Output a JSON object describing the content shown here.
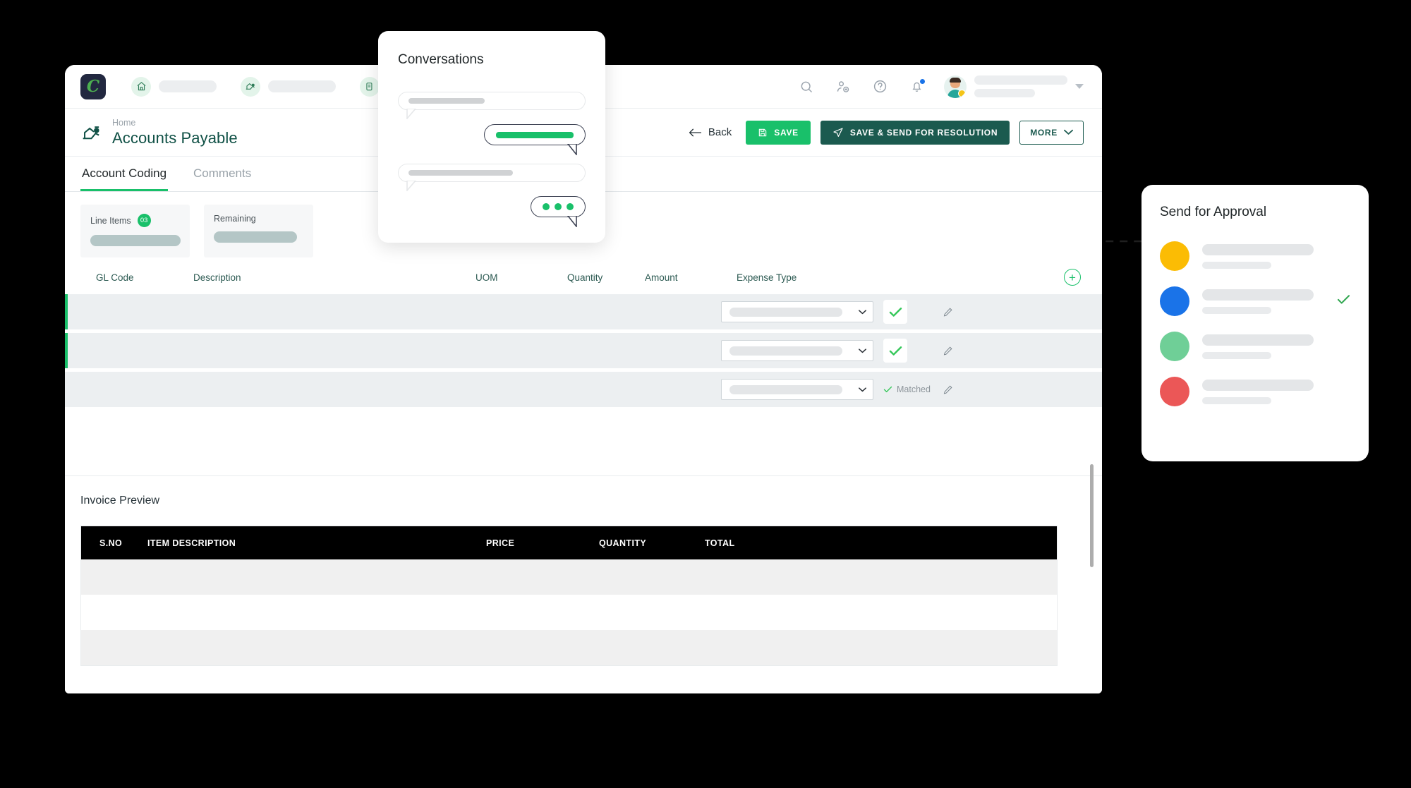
{
  "app": {
    "logo_glyph": "C",
    "nav_items": [
      {
        "icon": "home-icon",
        "pill_width": "w1"
      },
      {
        "icon": "invoice-icon",
        "pill_width": "w2"
      },
      {
        "icon": "documents-icon",
        "pill_width": "w3"
      }
    ],
    "nav_actions": [
      {
        "name": "search-icon"
      },
      {
        "name": "add-user-icon"
      },
      {
        "name": "help-icon"
      },
      {
        "name": "notifications-bell-icon"
      }
    ]
  },
  "header": {
    "breadcrumb": "Home",
    "title": "Accounts Payable",
    "back_label": "Back",
    "save_label": "SAVE",
    "resolution_label": "SAVE & SEND FOR RESOLUTION",
    "more_label": "MORE"
  },
  "tabs": [
    {
      "label": "Account Coding",
      "active": true
    },
    {
      "label": "Comments",
      "active": false
    }
  ],
  "summary": [
    {
      "label": "Line Items",
      "badge": "03"
    },
    {
      "label": "Remaining",
      "badge": ""
    }
  ],
  "coding_table": {
    "columns": [
      "GL Code",
      "Description",
      "UOM",
      "Quantity",
      "Amount",
      "Expense Type"
    ],
    "add_row_label": "+",
    "rows": [
      {
        "accent": true,
        "status": "check",
        "status_label": ""
      },
      {
        "accent": true,
        "status": "check",
        "status_label": ""
      },
      {
        "accent": false,
        "status": "matched",
        "status_label": "Matched"
      }
    ]
  },
  "preview": {
    "title": "Invoice Preview",
    "columns": [
      "S.NO",
      "ITEM DESCRIPTION",
      "PRICE",
      "QUANTITY",
      "TOTAL"
    ],
    "rows": [
      {
        "alt": true
      },
      {
        "alt": false
      },
      {
        "alt": true
      }
    ]
  },
  "conversations": {
    "title": "Conversations",
    "messages": [
      {
        "side": "left",
        "accent": false
      },
      {
        "side": "right",
        "accent": true
      },
      {
        "side": "left",
        "accent": false
      },
      {
        "side": "right",
        "accent": "typing"
      }
    ]
  },
  "approval": {
    "title": "Send for Approval",
    "rows": [
      {
        "color": "#fbbc04",
        "selected": false
      },
      {
        "color": "#1a73e8",
        "selected": true
      },
      {
        "color": "#6fcf97",
        "selected": false
      },
      {
        "color": "#eb5757",
        "selected": false
      }
    ]
  },
  "colors": {
    "brand_green": "#19c06a",
    "dark_green": "#1b5a4f",
    "title_teal": "#0f5045",
    "logo_navy": "#222840",
    "row_bg": "#eceff1"
  }
}
